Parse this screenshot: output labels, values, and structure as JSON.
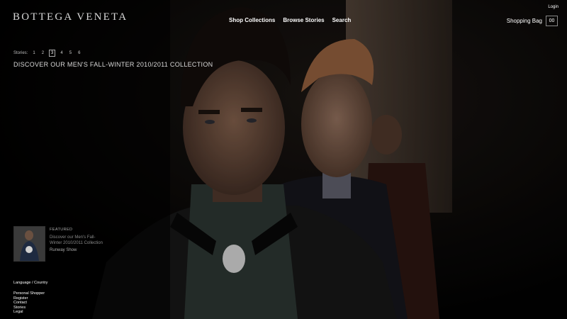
{
  "brand": {
    "logo": "BOTTEGA VENETA"
  },
  "nav": {
    "items": [
      "Shop Collections",
      "Browse Stories",
      "Search"
    ]
  },
  "account": {
    "login": "Login",
    "bag_label": "Shopping Bag",
    "bag_count": "00"
  },
  "stories": {
    "label": "Stories:",
    "numbers": [
      "1",
      "2",
      "3",
      "4",
      "5",
      "6"
    ],
    "active": "3"
  },
  "headline": "DISCOVER OUR MEN'S FALL-WINTER 2010/2011 COLLECTION",
  "featured": {
    "label": "FEATURED",
    "description": "Discover our Men's Fall-Winter 2010/2011 Collection",
    "link": "Runway Show"
  },
  "footer": {
    "language": "Language / Country",
    "links": [
      "Personal Shopper",
      "Register",
      "Contact",
      "Stories",
      "Legal"
    ]
  },
  "colors": {
    "background": "#000000",
    "text": "#ffffff"
  }
}
